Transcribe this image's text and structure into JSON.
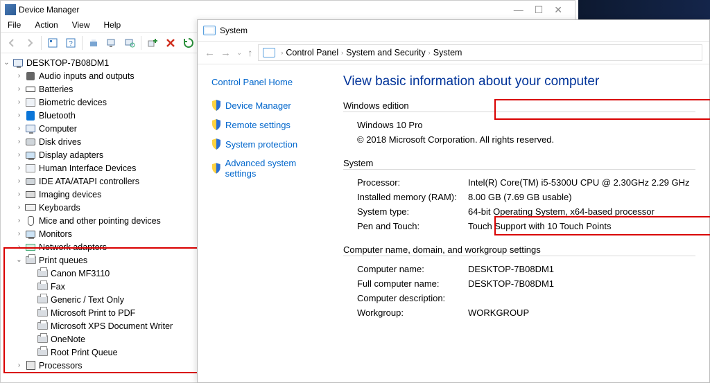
{
  "devmgr": {
    "title": "Device Manager",
    "menus": [
      "File",
      "Action",
      "View",
      "Help"
    ],
    "root": "DESKTOP-7B08DM1",
    "categories": [
      {
        "label": "Audio inputs and outputs",
        "icon": "speaker",
        "exp": ">"
      },
      {
        "label": "Batteries",
        "icon": "battery",
        "exp": ">"
      },
      {
        "label": "Biometric devices",
        "icon": "generic",
        "exp": ">"
      },
      {
        "label": "Bluetooth",
        "icon": "bluetooth",
        "exp": ">"
      },
      {
        "label": "Computer",
        "icon": "pc",
        "exp": ">"
      },
      {
        "label": "Disk drives",
        "icon": "disk",
        "exp": ">"
      },
      {
        "label": "Display adapters",
        "icon": "monitor",
        "exp": ">"
      },
      {
        "label": "Human Interface Devices",
        "icon": "generic",
        "exp": ">"
      },
      {
        "label": "IDE ATA/ATAPI controllers",
        "icon": "disk",
        "exp": ">"
      },
      {
        "label": "Imaging devices",
        "icon": "camera",
        "exp": ">"
      },
      {
        "label": "Keyboards",
        "icon": "keyboard",
        "exp": ">"
      },
      {
        "label": "Mice and other pointing devices",
        "icon": "mouse",
        "exp": ">"
      },
      {
        "label": "Monitors",
        "icon": "monitor",
        "exp": ">"
      },
      {
        "label": "Network adapters",
        "icon": "net",
        "exp": ">"
      },
      {
        "label": "Print queues",
        "icon": "printer",
        "exp": "v",
        "children": [
          {
            "label": "Canon MF3110"
          },
          {
            "label": "Fax"
          },
          {
            "label": "Generic / Text Only"
          },
          {
            "label": "Microsoft Print to PDF"
          },
          {
            "label": "Microsoft XPS Document Writer"
          },
          {
            "label": "OneNote"
          },
          {
            "label": "Root Print Queue"
          }
        ]
      },
      {
        "label": "Processors",
        "icon": "cpu",
        "exp": ">"
      }
    ]
  },
  "syswin": {
    "title": "System",
    "breadcrumb": [
      "Control Panel",
      "System and Security",
      "System"
    ],
    "side": {
      "cph": "Control Panel Home",
      "links": [
        "Device Manager",
        "Remote settings",
        "System protection",
        "Advanced system settings"
      ]
    },
    "heading": "View basic information about your computer",
    "edition": {
      "title": "Windows edition",
      "name": "Windows 10 Pro",
      "copyright": "© 2018 Microsoft Corporation. All rights reserved."
    },
    "system": {
      "title": "System",
      "rows": [
        {
          "label": "Processor:",
          "value": "Intel(R) Core(TM) i5-5300U CPU @ 2.30GHz   2.29 GHz"
        },
        {
          "label": "Installed memory (RAM):",
          "value": "8.00 GB (7.69 GB usable)"
        },
        {
          "label": "System type:",
          "value": "64-bit Operating System, x64-based processor"
        },
        {
          "label": "Pen and Touch:",
          "value": "Touch Support with 10 Touch Points"
        }
      ]
    },
    "naming": {
      "title": "Computer name, domain, and workgroup settings",
      "rows": [
        {
          "label": "Computer name:",
          "value": "DESKTOP-7B08DM1"
        },
        {
          "label": "Full computer name:",
          "value": "DESKTOP-7B08DM1"
        },
        {
          "label": "Computer description:",
          "value": ""
        },
        {
          "label": "Workgroup:",
          "value": "WORKGROUP"
        }
      ]
    }
  }
}
